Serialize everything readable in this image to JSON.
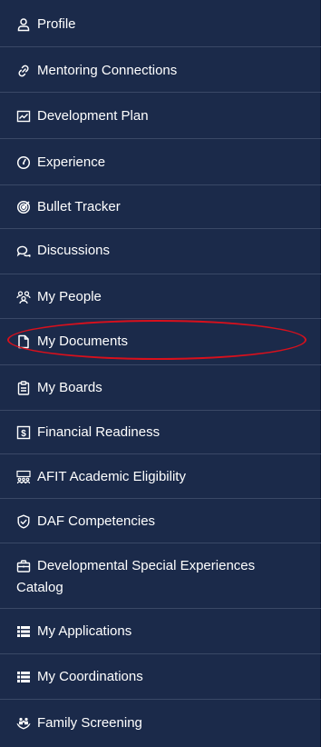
{
  "nav": {
    "items": [
      {
        "label": "Profile",
        "icon": "user-icon"
      },
      {
        "label": "Mentoring Connections",
        "icon": "link-icon"
      },
      {
        "label": "Development Plan",
        "icon": "trend-chart-icon"
      },
      {
        "label": "Experience",
        "icon": "gauge-icon"
      },
      {
        "label": "Bullet Tracker",
        "icon": "target-icon"
      },
      {
        "label": "Discussions",
        "icon": "chat-bubbles-icon"
      },
      {
        "label": "My People",
        "icon": "people-icon"
      },
      {
        "label": "My Documents",
        "icon": "document-icon"
      },
      {
        "label": "My Boards",
        "icon": "clipboard-icon"
      },
      {
        "label": "Financial Readiness",
        "icon": "dollar-icon"
      },
      {
        "label": "AFIT Academic Eligibility",
        "icon": "group-board-icon"
      },
      {
        "label": "DAF Competencies",
        "icon": "shield-check-icon"
      },
      {
        "label": "Developmental Special Experiences",
        "label_line2": "Catalog",
        "icon": "briefcase-icon"
      },
      {
        "label": "My Applications",
        "icon": "list-icon"
      },
      {
        "label": "My Coordinations",
        "icon": "list-icon"
      },
      {
        "label": "Family Screening",
        "icon": "family-hands-icon"
      }
    ],
    "highlighted_item": "My Documents"
  },
  "colors": {
    "background": "#1b2a4a",
    "divider": "#3a4866",
    "text": "#ffffff",
    "highlight": "#d8101c"
  }
}
